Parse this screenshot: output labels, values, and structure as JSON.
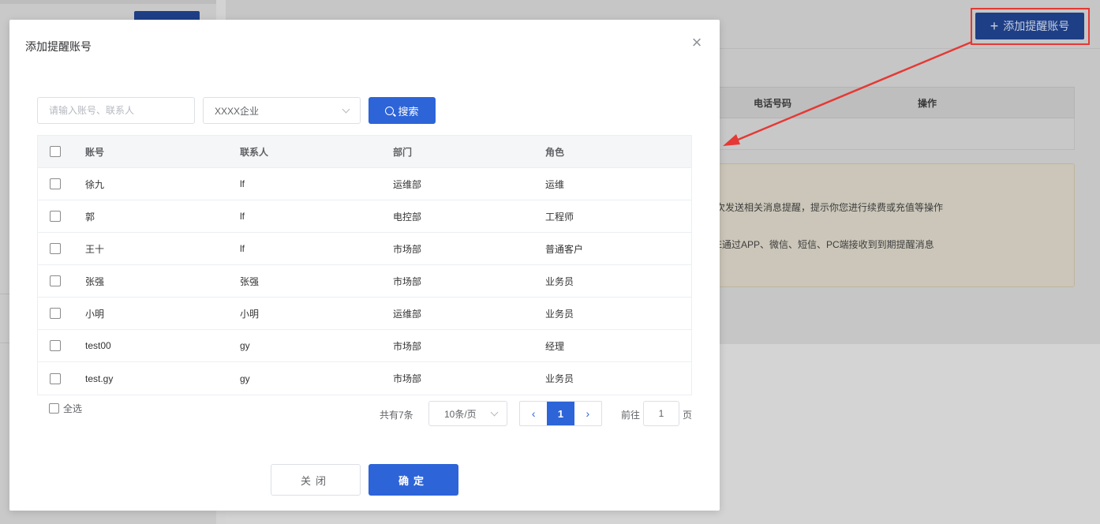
{
  "background": {
    "add_button_label": "添加提醒账号",
    "table_headers": [
      "电话号码",
      "操作"
    ],
    "notice_lines": [
      "次发送相关消息提醒，提示你您进行续费或充值等操作",
      "E通过APP、微信、短信、PC端接收到到期提醒消息"
    ],
    "colors": {
      "highlight": "#e53935",
      "arrow": "#e53935"
    }
  },
  "modal": {
    "title": "添加提醒账号",
    "close_icon": "×",
    "search": {
      "placeholder": "请输入账号、联系人",
      "company_value": "XXXX企业",
      "button_label": "搜索"
    },
    "table": {
      "headers": [
        "账号",
        "联系人",
        "部门",
        "角色"
      ],
      "rows": [
        [
          "徐九",
          "lf",
          "运维部",
          "运维"
        ],
        [
          "郭",
          "lf",
          "电控部",
          "工程师"
        ],
        [
          "王十",
          "lf",
          "市场部",
          "普通客户"
        ],
        [
          "张强",
          "张强",
          "市场部",
          "业务员"
        ],
        [
          "小明",
          "小明",
          "运维部",
          "业务员"
        ],
        [
          "test00",
          "gy",
          "市场部",
          "经理"
        ],
        [
          "test.gy",
          "gy",
          "市场部",
          "业务员"
        ]
      ]
    },
    "select_all_label": "全选",
    "pagination": {
      "total_text": "共有7条",
      "page_size": "10条/页",
      "current_page": "1",
      "goto_label": "前往",
      "goto_value": "1",
      "page_unit": "页"
    },
    "footer": {
      "close_label": "关闭",
      "confirm_label": "确定"
    },
    "colors": {
      "primary": "#2d64d8"
    }
  }
}
